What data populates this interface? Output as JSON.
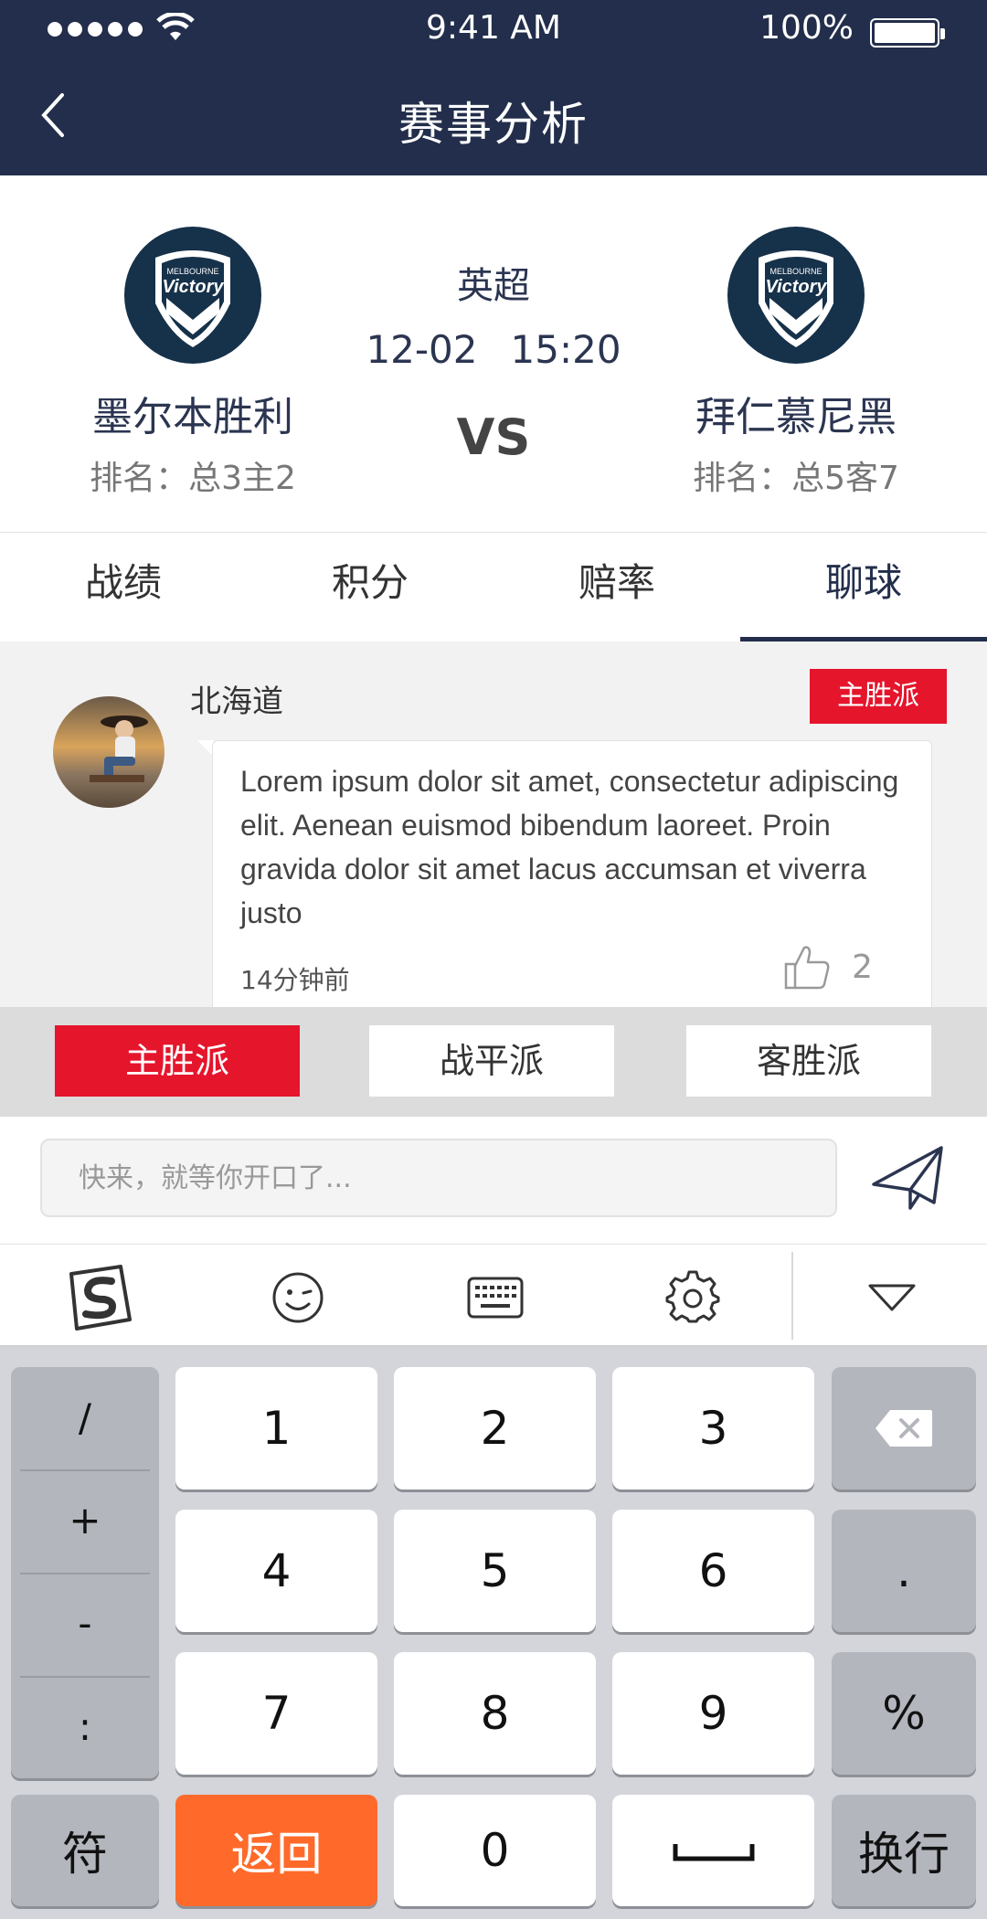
{
  "status_bar": {
    "time": "9:41 AM",
    "battery": "100%"
  },
  "header": {
    "title": "赛事分析",
    "back_icon": "chevron-left-icon"
  },
  "match": {
    "league": "英超",
    "date": "12-02",
    "time": "15:20",
    "vs": "VS",
    "home": {
      "name": "墨尔本胜利",
      "rank": "排名：总3主2",
      "logo_text_top": "MELBOURNE",
      "logo_text": "Victory"
    },
    "away": {
      "name": "拜仁慕尼黑",
      "rank": "排名：总5客7",
      "logo_text_top": "MELBOURNE",
      "logo_text": "Victory"
    }
  },
  "tabs": [
    {
      "label": "战绩",
      "active": false
    },
    {
      "label": "积分",
      "active": false
    },
    {
      "label": "赔率",
      "active": false
    },
    {
      "label": "聊球",
      "active": true
    }
  ],
  "chat": {
    "message": {
      "username": "北海道",
      "badge": "主胜派",
      "text": "Lorem ipsum dolor sit amet, consectetur adipiscing elit. Aenean euismod bibendum laoreet. Proin gravida dolor sit amet lacus accumsan et viverra justo",
      "time": "14分钟前",
      "likes": "2"
    }
  },
  "stances": [
    {
      "label": "主胜派",
      "active": true
    },
    {
      "label": "战平派",
      "active": false
    },
    {
      "label": "客胜派",
      "active": false
    }
  ],
  "input": {
    "placeholder": "快来，就等你开口了...",
    "send_icon": "paper-plane-icon"
  },
  "keyboard_toolbar": [
    "sogou-logo-icon",
    "emoji-icon",
    "keyboard-icon",
    "settings-gear-icon",
    "collapse-triangle-icon"
  ],
  "keyboard": {
    "symbols": [
      "/",
      "+",
      "-",
      ":"
    ],
    "digits": [
      "1",
      "2",
      "3",
      "4",
      "5",
      "6",
      "7",
      "8",
      "9",
      "0"
    ],
    "right": [
      "",
      ".",
      "%"
    ],
    "bottom": {
      "sym": "符",
      "back": "返回",
      "enter": "换行"
    }
  },
  "colors": {
    "header_bg": "#222e4b",
    "accent_red": "#e5152c",
    "key_orange": "#ff6a2b"
  }
}
